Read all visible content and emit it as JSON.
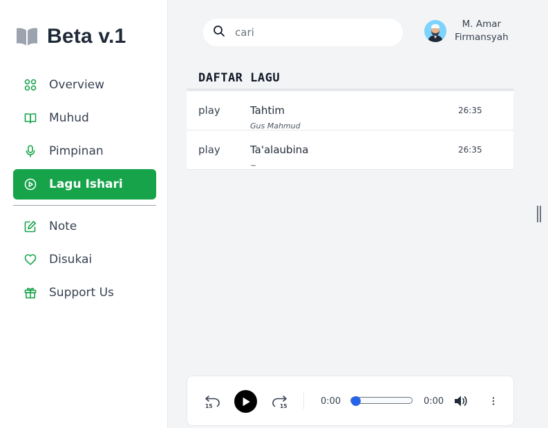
{
  "brand": {
    "title": "Beta v.1"
  },
  "sidebar": {
    "items": [
      {
        "label": "Overview",
        "icon": "grid-icon"
      },
      {
        "label": "Muhud",
        "icon": "book-open-icon"
      },
      {
        "label": "Pimpinan",
        "icon": "microphone-icon"
      },
      {
        "label": "Lagu Ishari",
        "icon": "play-circle-icon",
        "active": true
      },
      {
        "label": "Note",
        "icon": "edit-icon"
      },
      {
        "label": "Disukai",
        "icon": "heart-icon"
      },
      {
        "label": "Support Us",
        "icon": "gift-icon"
      }
    ]
  },
  "search": {
    "placeholder": "cari",
    "value": ""
  },
  "user": {
    "name_line1": "M. Amar",
    "name_line2": "Firmansyah"
  },
  "list": {
    "title": "DAFTAR LAGU",
    "songs": [
      {
        "action": "play",
        "title": "Tahtim",
        "artist": "Gus Mahmud",
        "duration": "26:35"
      },
      {
        "action": "play",
        "title": "Ta'alaubina",
        "artist": "~",
        "duration": "26:35"
      }
    ]
  },
  "player": {
    "current_time": "0:00",
    "total_time": "0:00",
    "rewind_seconds": "15",
    "forward_seconds": "15",
    "progress": 0
  },
  "colors": {
    "accent": "#16a34a",
    "background": "#f3f4f6",
    "progress_thumb": "#2563eb"
  }
}
